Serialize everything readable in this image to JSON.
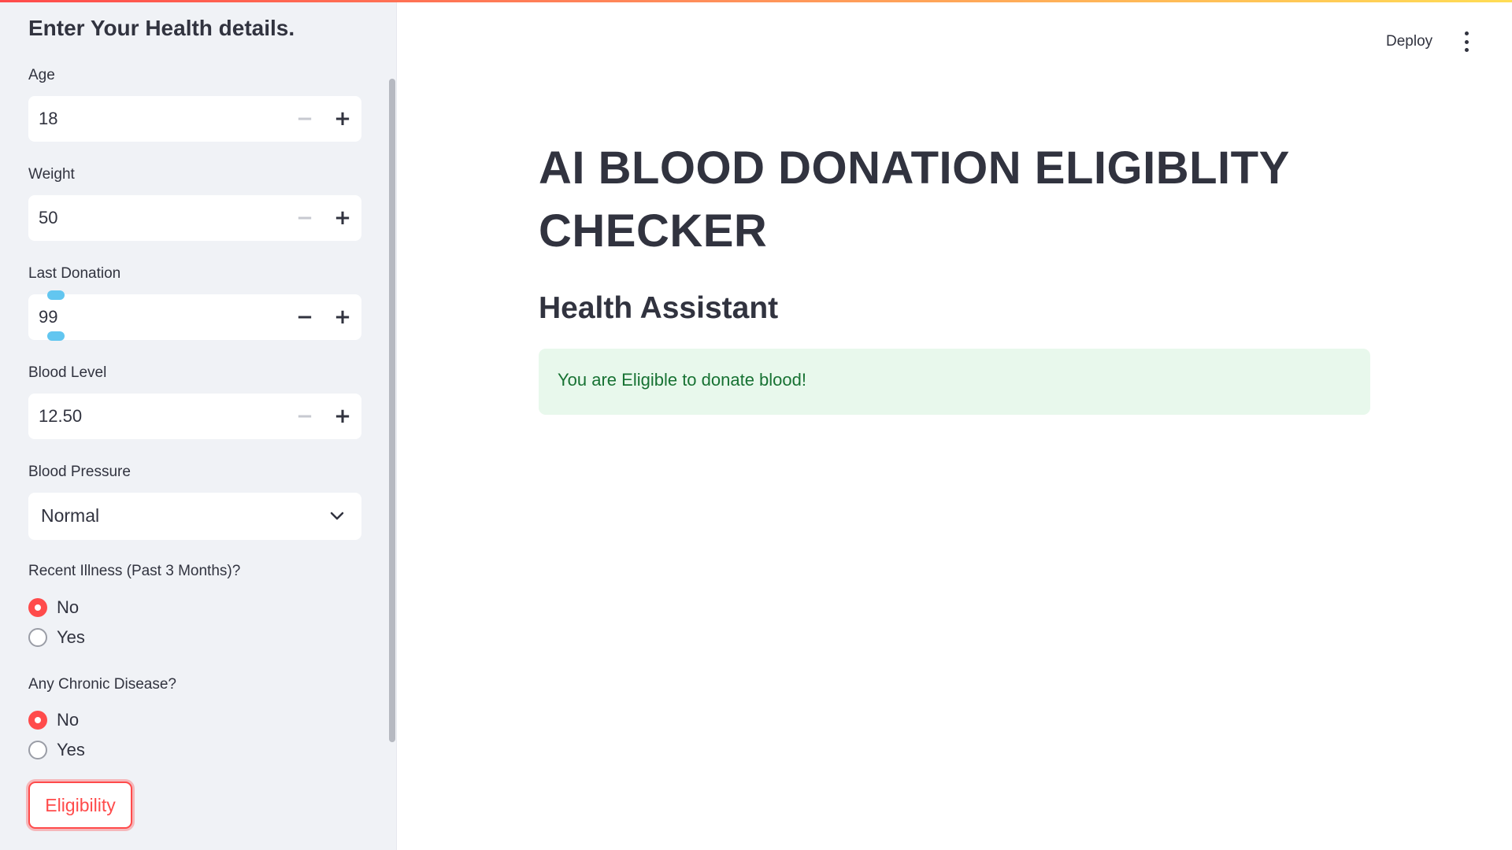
{
  "sidebar": {
    "title": "Enter Your Health details.",
    "fields": {
      "age": {
        "label": "Age",
        "value": "18"
      },
      "weight": {
        "label": "Weight",
        "value": "50"
      },
      "last_donation": {
        "label": "Last Donation",
        "value": "99"
      },
      "blood_level": {
        "label": "Blood Level",
        "value": "12.50"
      }
    },
    "stepper": {
      "minus": "−",
      "plus": "+"
    },
    "blood_pressure": {
      "label": "Blood Pressure",
      "selected": "Normal"
    },
    "recent_illness": {
      "label": "Recent Illness (Past 3 Months)?",
      "options": [
        "No",
        "Yes"
      ],
      "selected": "No"
    },
    "chronic_disease": {
      "label": "Any Chronic Disease?",
      "options": [
        "No",
        "Yes"
      ],
      "selected": "No"
    },
    "submit_label": "Eligibility"
  },
  "header": {
    "deploy_label": "Deploy",
    "menu_icon": "more-vertical-icon"
  },
  "main": {
    "title": "AI BLOOD DONATION ELIGIBLITY CHECKER",
    "subtitle": "Health Assistant",
    "result_message": "You are Eligible to donate blood!"
  },
  "colors": {
    "accent": "#ff4b4b",
    "sidebar_bg": "#f0f2f6",
    "success_bg": "#e8f8ec",
    "success_text": "#177233",
    "text": "#31333f"
  }
}
